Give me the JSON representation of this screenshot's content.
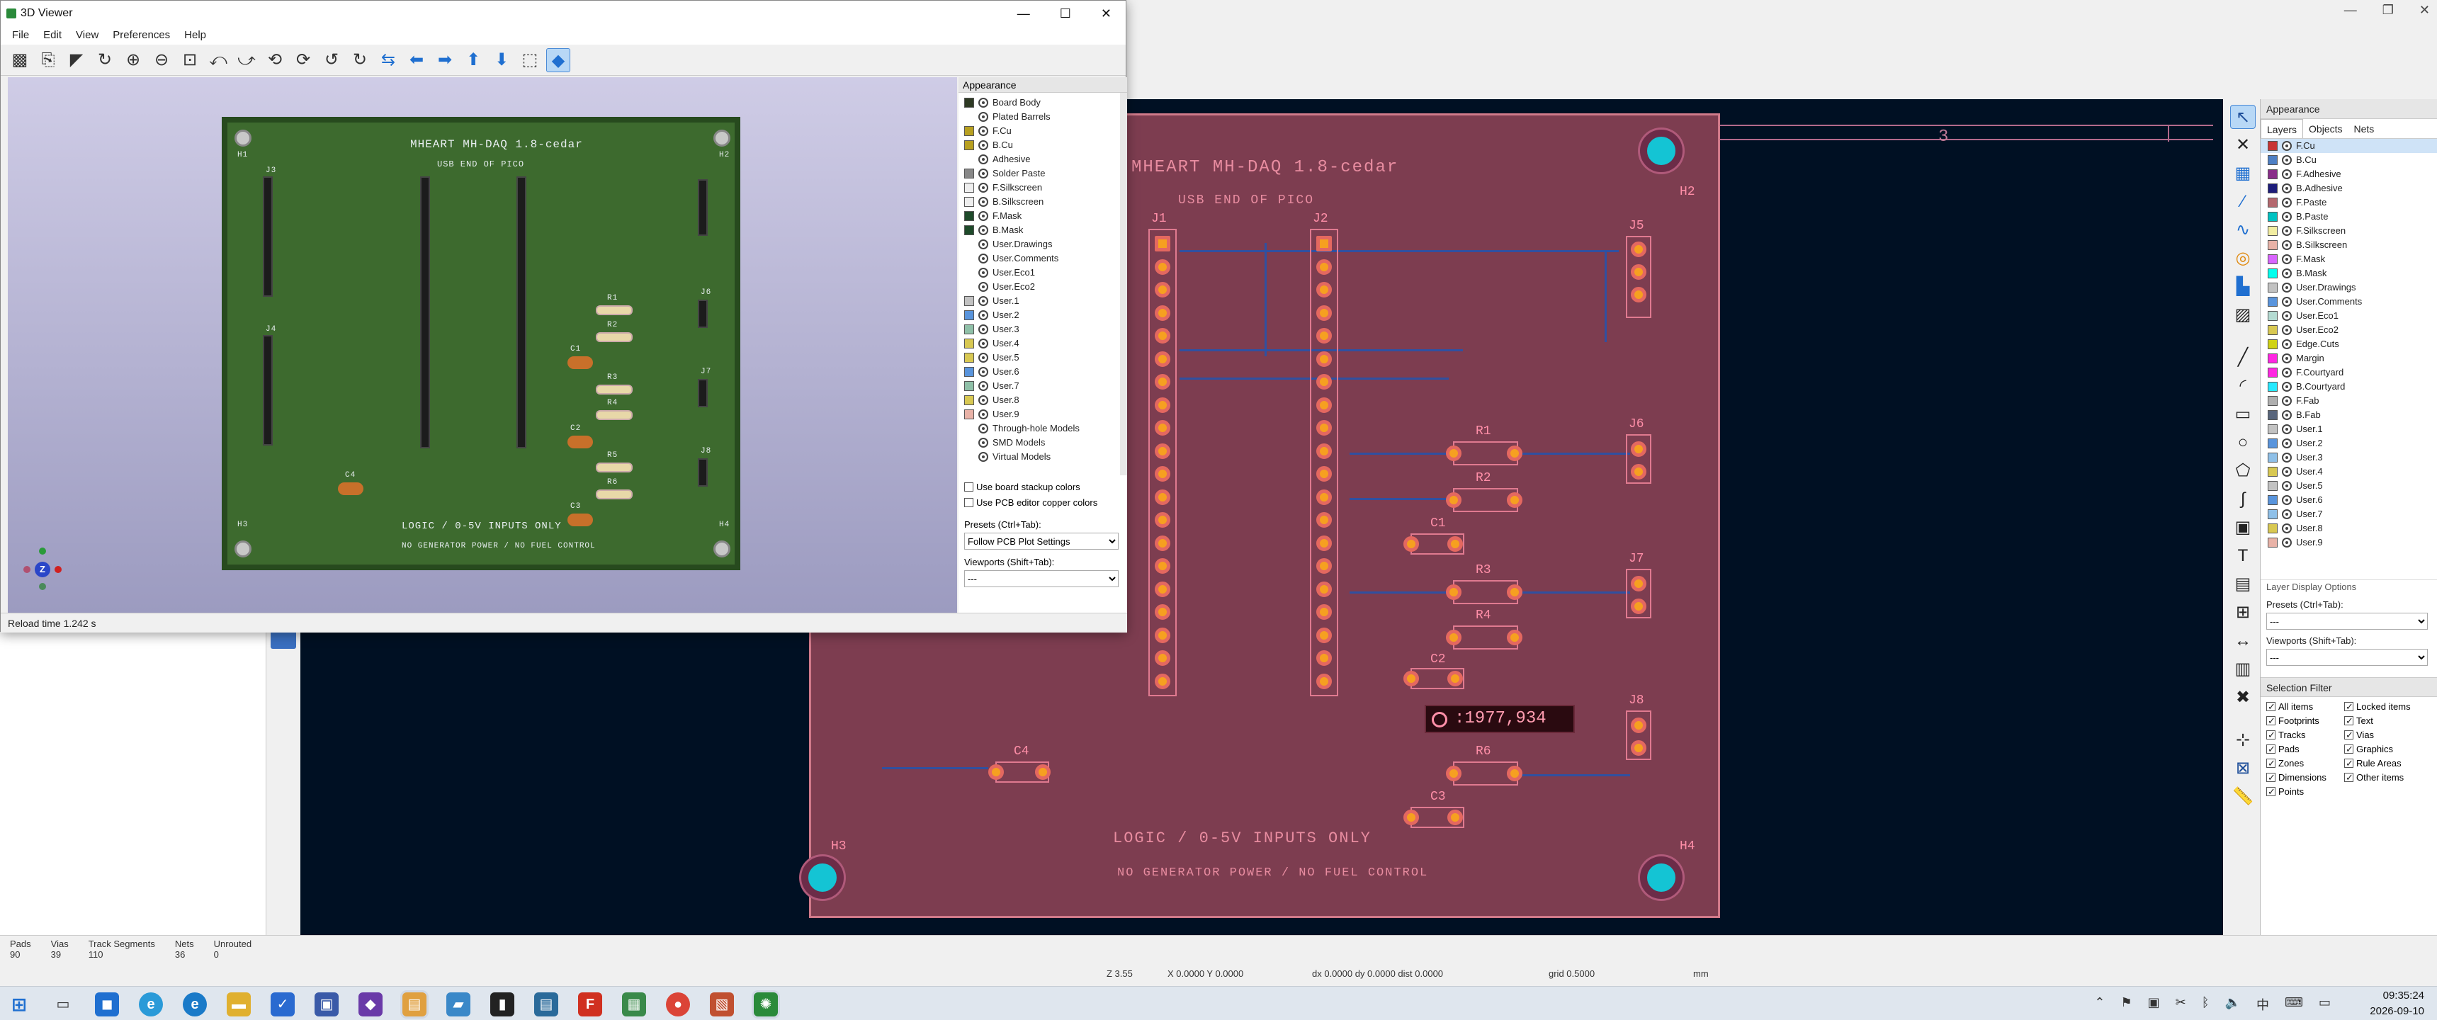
{
  "pcb_editor": {
    "window_controls": [
      "—",
      "❐",
      "✕"
    ],
    "right_panel": {
      "title": "Appearance",
      "tabs": [
        "Layers",
        "Objects",
        "Nets"
      ],
      "layers": [
        {
          "name": "F.Cu",
          "color": "#c83434",
          "selected": true
        },
        {
          "name": "B.Cu",
          "color": "#4d7fc4"
        },
        {
          "name": "F.Adhesive",
          "color": "#8a2e8a"
        },
        {
          "name": "B.Adhesive",
          "color": "#1d1d7a"
        },
        {
          "name": "F.Paste",
          "color": "#b4686e"
        },
        {
          "name": "B.Paste",
          "color": "#00c2c2"
        },
        {
          "name": "F.Silkscreen",
          "color": "#f2eda1"
        },
        {
          "name": "B.Silkscreen",
          "color": "#e8b2a7"
        },
        {
          "name": "F.Mask",
          "color": "#d864ff"
        },
        {
          "name": "B.Mask",
          "color": "#02ffee"
        },
        {
          "name": "User.Drawings",
          "color": "#c2c2c2"
        },
        {
          "name": "User.Comments",
          "color": "#5994dc"
        },
        {
          "name": "User.Eco1",
          "color": "#b4dbd2"
        },
        {
          "name": "User.Eco2",
          "color": "#d8c852"
        },
        {
          "name": "Edge.Cuts",
          "color": "#d0d214"
        },
        {
          "name": "Margin",
          "color": "#ff26e2"
        },
        {
          "name": "F.Courtyard",
          "color": "#ff26e2"
        },
        {
          "name": "B.Courtyard",
          "color": "#26e9ff"
        },
        {
          "name": "F.Fab",
          "color": "#afafaf"
        },
        {
          "name": "B.Fab",
          "color": "#58657b"
        },
        {
          "name": "User.1",
          "color": "#c2c2c2"
        },
        {
          "name": "User.2",
          "color": "#5994dc"
        },
        {
          "name": "User.3",
          "color": "#8fc0e8"
        },
        {
          "name": "User.4",
          "color": "#d8c852"
        },
        {
          "name": "User.5",
          "color": "#c2c2c2"
        },
        {
          "name": "User.6",
          "color": "#5994dc"
        },
        {
          "name": "User.7",
          "color": "#8fc0e8"
        },
        {
          "name": "User.8",
          "color": "#d8c852"
        },
        {
          "name": "User.9",
          "color": "#e8b2a7"
        }
      ],
      "layer_display_options": "Layer Display Options",
      "presets_label": "Presets (Ctrl+Tab):",
      "presets_value": "---",
      "viewports_label": "Viewports (Shift+Tab):",
      "viewports_value": "---",
      "selection_filter_title": "Selection Filter",
      "selection_filter": [
        [
          "All items",
          "Locked items"
        ],
        [
          "Footprints",
          "Text"
        ],
        [
          "Tracks",
          "Vias"
        ],
        [
          "Pads",
          "Graphics"
        ],
        [
          "Zones",
          "Rule Areas"
        ],
        [
          "Dimensions",
          "Other items"
        ],
        [
          "Points",
          ""
        ]
      ]
    },
    "board": {
      "title": "MHEART MH-DAQ 1.8-cedar",
      "subtitle": "USB END OF PICO",
      "footer1": "LOGIC / 0-5V INPUTS ONLY",
      "footer2": "NO GENERATOR POWER / NO FUEL CONTROL",
      "holes": [
        "H2",
        "H3",
        "H4"
      ],
      "connectors": [
        "J1",
        "J2",
        "J5",
        "J6",
        "J7",
        "J8"
      ],
      "resistors": [
        "R1",
        "R2",
        "R3",
        "R4",
        "R6"
      ],
      "capacitors": [
        "C1",
        "C2",
        "C3",
        "C4"
      ],
      "sheet_number": "3",
      "coord_popup": ":1977,934"
    },
    "status": {
      "headers": [
        "Pads",
        "Vias",
        "Track Segments",
        "Nets",
        "Unrouted"
      ],
      "values": [
        "90",
        "39",
        "110",
        "36",
        "0"
      ],
      "zoom": "Z 3.55",
      "xy": "X 0.0000  Y 0.0000",
      "delta": "dx 0.0000  dy 0.0000  dist 0.0000",
      "grid": "grid 0.5000",
      "units": "mm"
    }
  },
  "viewer": {
    "title": "3D Viewer",
    "menu": [
      "File",
      "Edit",
      "View",
      "Preferences",
      "Help"
    ],
    "window_controls": [
      "—",
      "☐",
      "✕"
    ],
    "status": "Reload time 1.242 s",
    "appearance": {
      "title": "Appearance",
      "items": [
        {
          "name": "Board Body",
          "color": "#2e3a24"
        },
        {
          "name": "Plated Barrels",
          "color": ""
        },
        {
          "name": "F.Cu",
          "color": "#b8a020"
        },
        {
          "name": "B.Cu",
          "color": "#b8a020"
        },
        {
          "name": "Adhesive",
          "color": ""
        },
        {
          "name": "Solder Paste",
          "color": "#888888"
        },
        {
          "name": "F.Silkscreen",
          "color": "#eeeeee"
        },
        {
          "name": "B.Silkscreen",
          "color": "#eeeeee"
        },
        {
          "name": "F.Mask",
          "color": "#1e4a2a"
        },
        {
          "name": "B.Mask",
          "color": "#1e4a2a"
        },
        {
          "name": "User.Drawings",
          "color": ""
        },
        {
          "name": "User.Comments",
          "color": ""
        },
        {
          "name": "User.Eco1",
          "color": ""
        },
        {
          "name": "User.Eco2",
          "color": ""
        },
        {
          "name": "User.1",
          "color": "#c2c2c2"
        },
        {
          "name": "User.2",
          "color": "#5994dc"
        },
        {
          "name": "User.3",
          "color": "#8fc0a8"
        },
        {
          "name": "User.4",
          "color": "#d8c852"
        },
        {
          "name": "User.5",
          "color": "#d8c852"
        },
        {
          "name": "User.6",
          "color": "#5994dc"
        },
        {
          "name": "User.7",
          "color": "#8fc0a8"
        },
        {
          "name": "User.8",
          "color": "#d8c852"
        },
        {
          "name": "User.9",
          "color": "#e8b2a7"
        },
        {
          "name": "Through-hole Models",
          "color": ""
        },
        {
          "name": "SMD Models",
          "color": ""
        },
        {
          "name": "Virtual Models",
          "color": ""
        }
      ],
      "check1": "Use board stackup colors",
      "check2": "Use PCB editor copper colors",
      "presets_label": "Presets (Ctrl+Tab):",
      "presets_value": "Follow PCB Plot Settings",
      "viewports_label": "Viewports (Shift+Tab):",
      "viewports_value": "---"
    },
    "board": {
      "title": "MHEART MH-DAQ 1.8-cedar",
      "subtitle": "USB END OF PICO",
      "footer1": "LOGIC / 0-5V INPUTS ONLY",
      "footer2": "NO GENERATOR POWER / NO FUEL CONTROL",
      "labels": [
        "H1",
        "H2",
        "H3",
        "H4",
        "J3",
        "J4",
        "J6",
        "J7",
        "J8",
        "R1",
        "R2",
        "R3",
        "R4",
        "R5",
        "R6",
        "C1",
        "C2",
        "C3",
        "C4"
      ],
      "axis_label": "Z"
    }
  },
  "taskbar": {
    "time": "09:35:24",
    "date": "2026-09-10",
    "ime": "中"
  }
}
